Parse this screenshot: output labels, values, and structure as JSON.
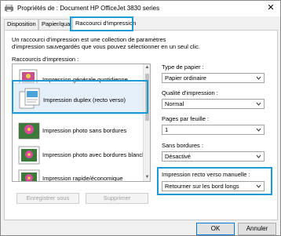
{
  "window": {
    "title": "Propriétés de : Document HP OfficeJet 3830 series",
    "close_glyph": "✕"
  },
  "tabs": [
    {
      "label": "Disposition"
    },
    {
      "label": "Papier/qualité"
    },
    {
      "label": "Raccourci d'impression",
      "active": true
    }
  ],
  "description": "Un raccourci d'impression est une collection de paramètres d'impression sauvegardés que vous pouvez sélectionner en un seul clic.",
  "shortcuts": {
    "label": "Raccourcis d'impression :",
    "items": [
      {
        "label": "Impression générale quotidienne",
        "icon": "paper-sheet-icon"
      },
      {
        "label": "Impression duplex (recto verso)",
        "icon": "duplex-document-icon",
        "selected": true
      },
      {
        "label": "Impression photo sans bordures",
        "icon": "photo-flower-icon"
      },
      {
        "label": "Impression photo avec bordures blanches",
        "icon": "photo-flower-icon"
      },
      {
        "label": "Impression rapide/économique",
        "icon": "photo-flower-icon"
      }
    ],
    "save_button": "Enregistrer sous",
    "delete_button": "Supprimer"
  },
  "settings": {
    "paper_type": {
      "label": "Type de papier :",
      "value": "Papier ordinaire"
    },
    "print_quality": {
      "label": "Qualité d'impression :",
      "value": "Normal"
    },
    "pages_per_sheet": {
      "label": "Pages par feuille :",
      "value": "1"
    },
    "borderless": {
      "label": "Sans bordures :",
      "value": "Désactivé"
    },
    "duplex_manual": {
      "label": "Impression recto verso manuelle :",
      "value": "Retourner sur les bord longs"
    }
  },
  "footer": {
    "ok": "OK",
    "cancel": "Annuler"
  },
  "colors": {
    "highlight": "#1c9ad6",
    "selected_bg": "#e6f0fa",
    "window_bg": "#f0f0f0"
  }
}
